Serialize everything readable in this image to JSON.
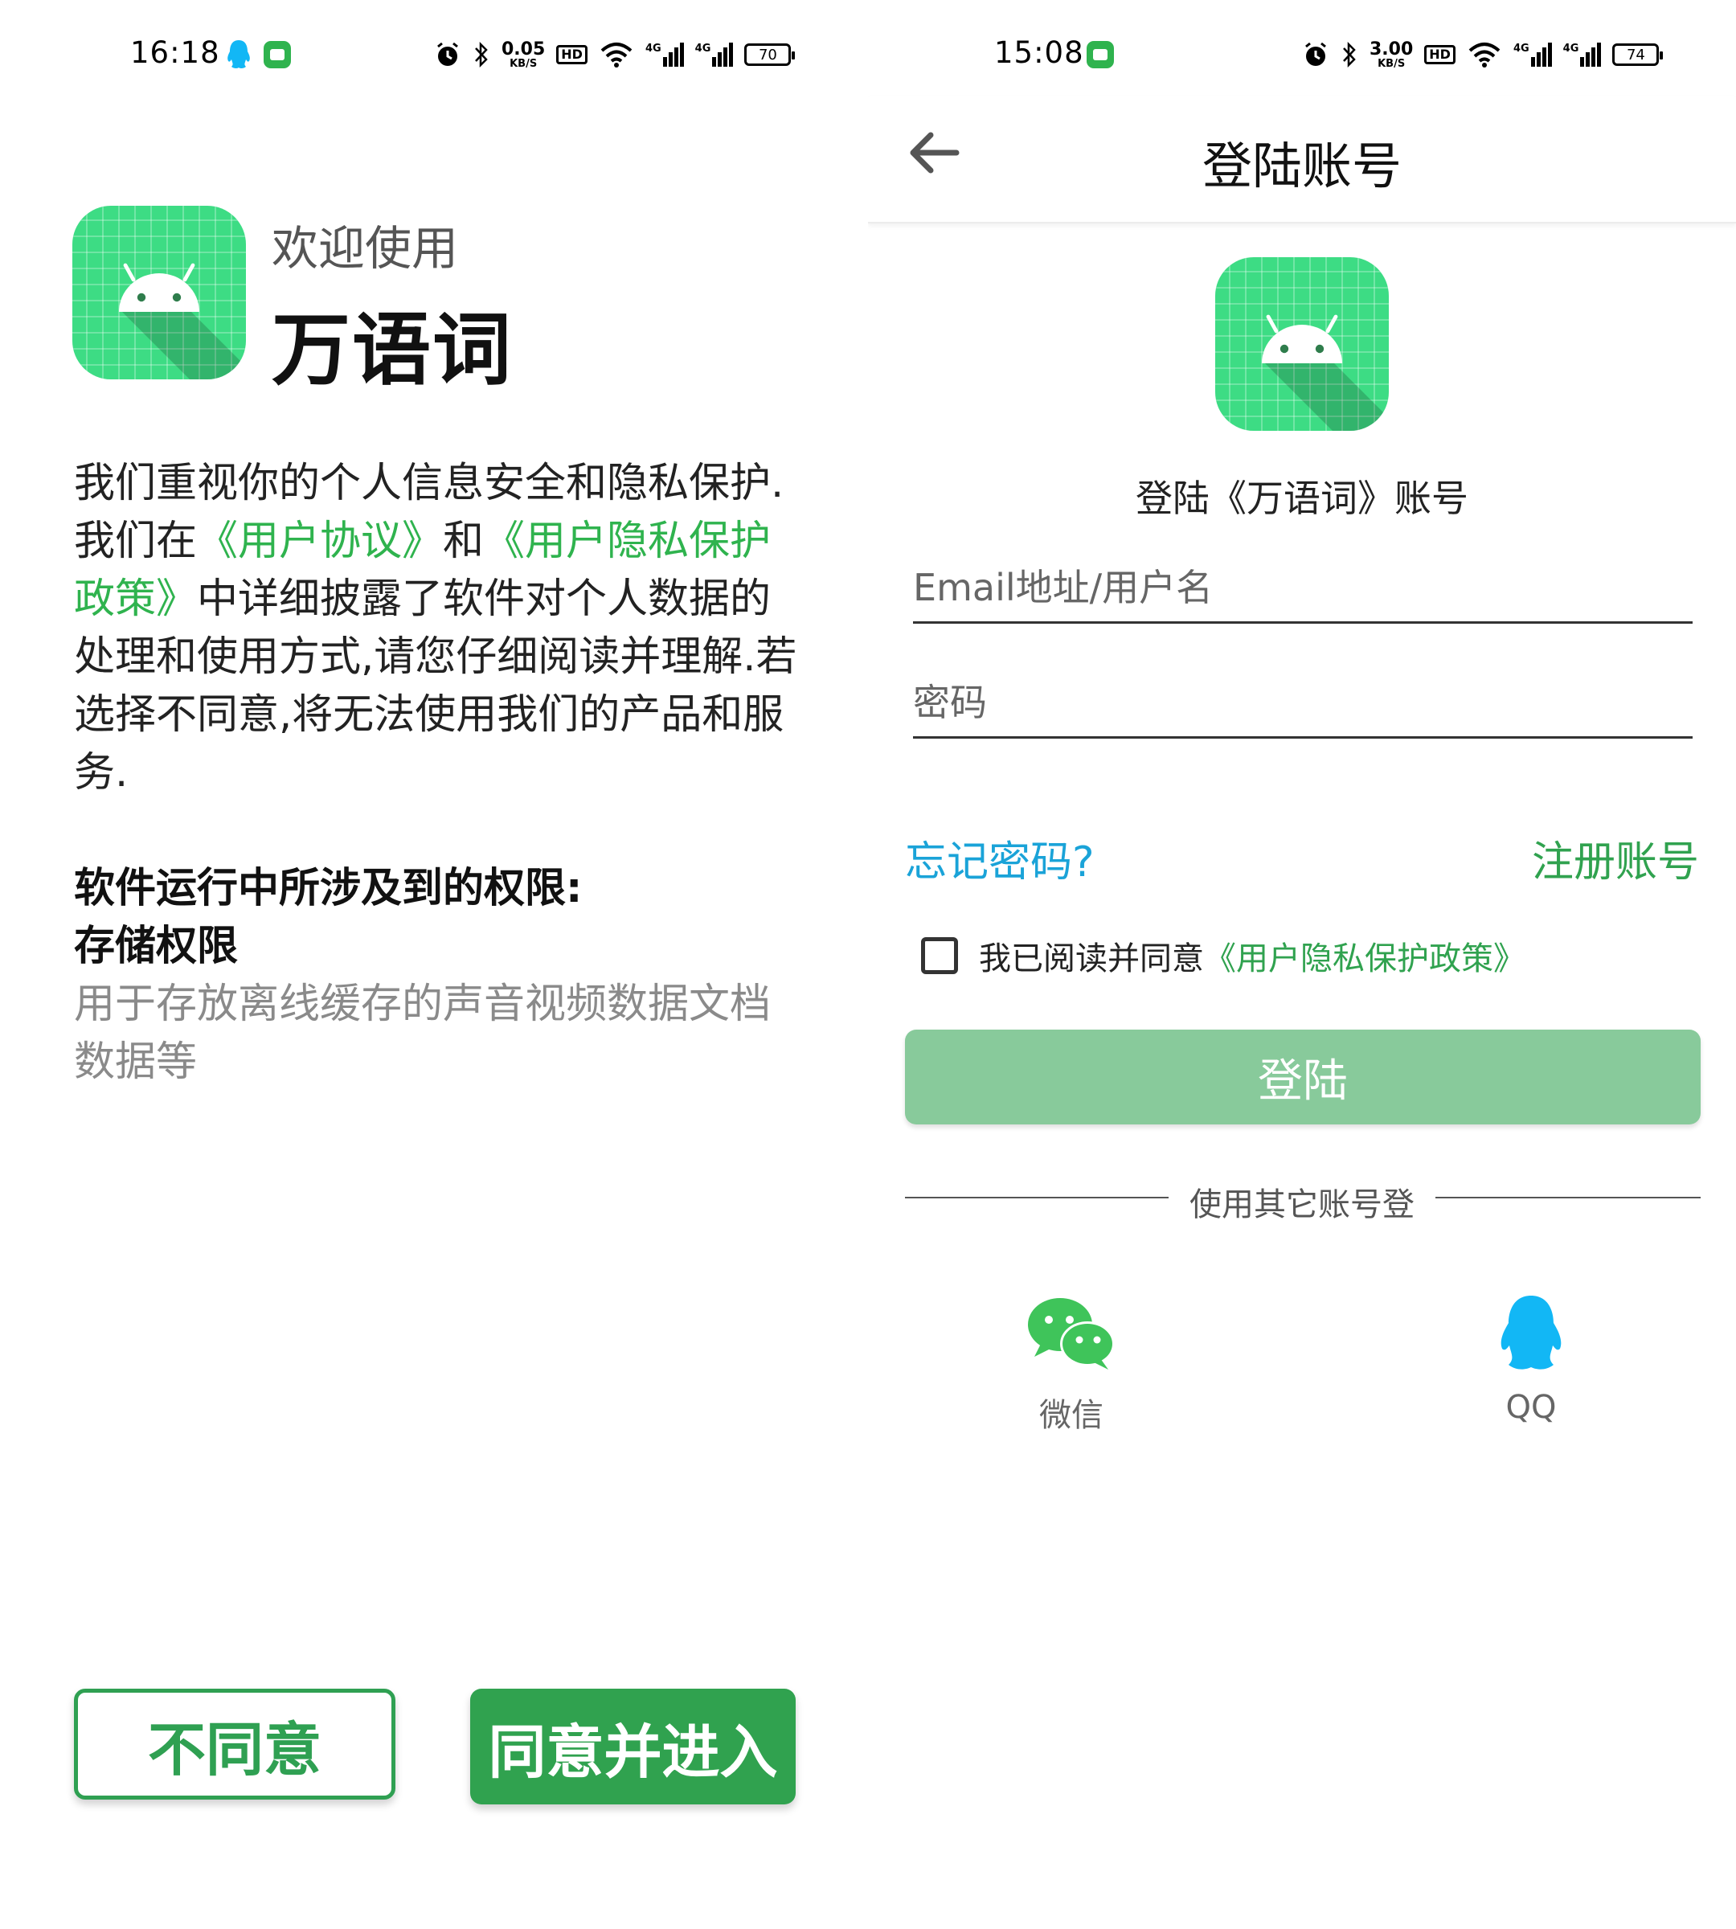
{
  "left": {
    "status": {
      "time": "16:18",
      "speed_value": "0.05",
      "speed_unit": "KB/S",
      "hd": "HD",
      "net1": "4G",
      "net2": "4G",
      "battery": "70"
    },
    "welcome": "欢迎使用",
    "app_name": "万语词",
    "privacy": {
      "p1": "我们重视你的个人信息安全和隐私保护.我们在",
      "link1": "《用户协议》",
      "p2": "和",
      "link2": "《用户隐私保护政策》",
      "p3": "中详细披露了软件对个人数据的处理和使用方式,请您仔细阅读并理解.若选择不同意,将无法使用我们的产品和服务."
    },
    "permissions_title": "软件运行中所涉及到的权限:",
    "permission_name": "存储权限",
    "permission_desc": "用于存放离线缓存的声音视频数据文档数据等",
    "disagree_label": "不同意",
    "agree_label": "同意并进入"
  },
  "right": {
    "status": {
      "time": "15:08",
      "speed_value": "3.00",
      "speed_unit": "KB/S",
      "hd": "HD",
      "net1": "4G",
      "net2": "4G",
      "battery": "74"
    },
    "title": "登陆账号",
    "subtitle": "登陆《万语词》账号",
    "username_placeholder": "Email地址/用户名",
    "password_placeholder": "密码",
    "forgot": "忘记密码?",
    "register": "注册账号",
    "agree_text": "我已阅读并同意",
    "agree_link": "《用户隐私保护政策》",
    "login_label": "登陆",
    "other_login": "使用其它账号登",
    "wechat_label": "微信",
    "qq_label": "QQ"
  },
  "colors": {
    "green": "#30a24f",
    "light_green": "#88ca9b",
    "blue": "#1aa3d8",
    "qq_blue": "#12b7f5",
    "wechat_green": "#3fc45a"
  }
}
